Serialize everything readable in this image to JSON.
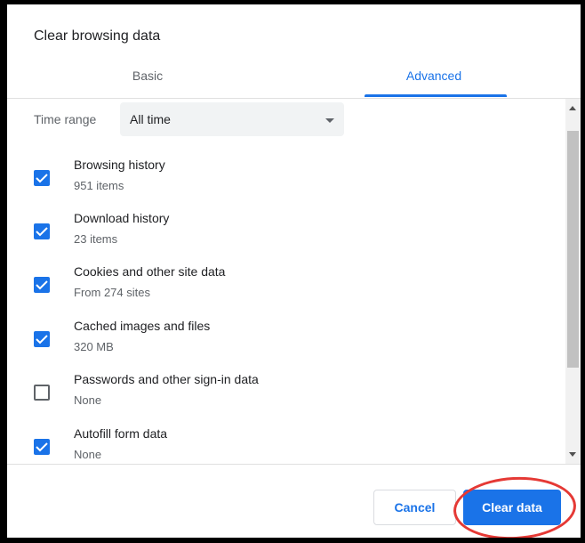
{
  "dialog": {
    "title": "Clear browsing data"
  },
  "tabs": [
    {
      "label": "Basic",
      "selected": false
    },
    {
      "label": "Advanced",
      "selected": true
    }
  ],
  "time_range": {
    "label": "Time range",
    "value": "All time"
  },
  "items": [
    {
      "label": "Browsing history",
      "detail": "951 items",
      "checked": true
    },
    {
      "label": "Download history",
      "detail": "23 items",
      "checked": true
    },
    {
      "label": "Cookies and other site data",
      "detail": "From 274 sites",
      "checked": true
    },
    {
      "label": "Cached images and files",
      "detail": "320 MB",
      "checked": true
    },
    {
      "label": "Passwords and other sign-in data",
      "detail": "None",
      "checked": false
    },
    {
      "label": "Autofill form data",
      "detail": "None",
      "checked": true
    }
  ],
  "buttons": {
    "cancel": "Cancel",
    "clear": "Clear data"
  },
  "colors": {
    "accent": "#1a73e8",
    "annotation": "#e53935"
  }
}
